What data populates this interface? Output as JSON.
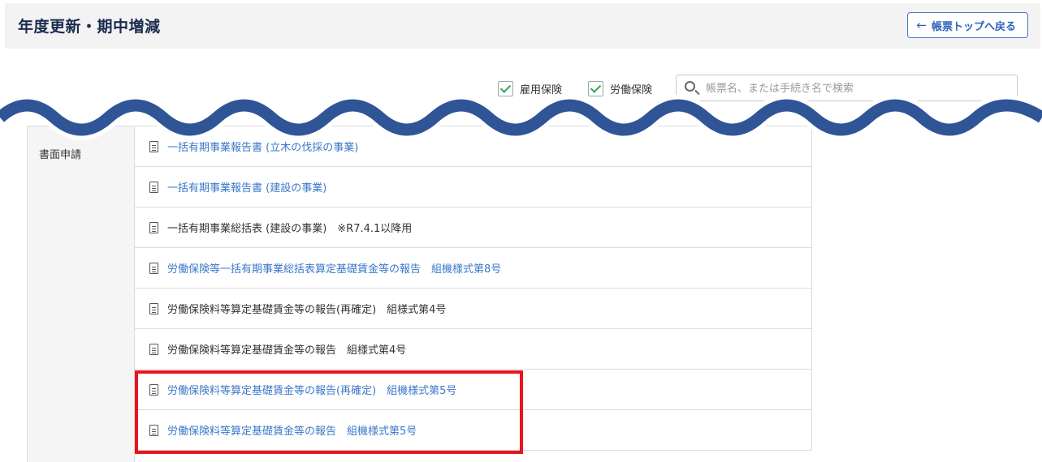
{
  "header": {
    "title": "年度更新・期中増減",
    "back_button_label": "帳票トップへ戻る"
  },
  "filters": {
    "employment_insurance_label": "雇用保険",
    "labor_insurance_label": "労働保険",
    "search_placeholder": "帳票名、または手続き名で検索"
  },
  "table": {
    "category_label": "書面申請",
    "rows": [
      {
        "label": "一括有期事業報告書 (立木の伐採の事業)",
        "is_link": true
      },
      {
        "label": "一括有期事業報告書 (建設の事業)",
        "is_link": true
      },
      {
        "label": "一括有期事業総括表 (建設の事業)　※R7.4.1以降用",
        "is_link": false
      },
      {
        "label": "労働保険等一括有期事業総括表算定基礎賃金等の報告　組機様式第8号",
        "is_link": true
      },
      {
        "label": "労働保険料等算定基礎賃金等の報告(再確定)　組様式第4号",
        "is_link": false
      },
      {
        "label": "労働保険料等算定基礎賃金等の報告　組様式第4号",
        "is_link": false
      },
      {
        "label": "労働保険料等算定基礎賃金等の報告(再確定)　組機様式第5号",
        "is_link": true
      },
      {
        "label": "労働保険料等算定基礎賃金等の報告　組機様式第5号",
        "is_link": true
      }
    ]
  },
  "colors": {
    "title": "#1b2a4e",
    "link": "#3b78c9",
    "wave": "#2f5597",
    "highlight": "#e8141c"
  }
}
